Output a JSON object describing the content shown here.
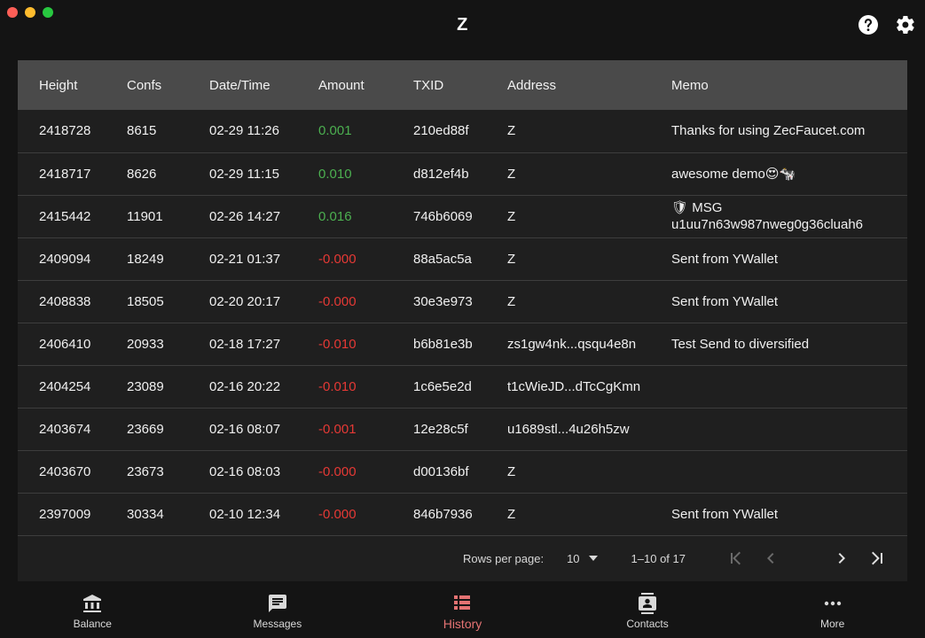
{
  "app": {
    "title": "Z"
  },
  "colors": {
    "positive": "#4caf50",
    "negative": "#e53935",
    "accent": "#e57373"
  },
  "table": {
    "columns": [
      "Height",
      "Confs",
      "Date/Time",
      "Amount",
      "TXID",
      "Address",
      "Memo"
    ],
    "rows": [
      {
        "height": "2418728",
        "confs": "8615",
        "datetime": "02-29 11:26",
        "amount": "0.001",
        "sign": "pos",
        "txid": "210ed88f",
        "address": "Z",
        "memo": "Thanks for using ZecFaucet.com"
      },
      {
        "height": "2418717",
        "confs": "8626",
        "datetime": "02-29 11:15",
        "amount": "0.010",
        "sign": "pos",
        "txid": "d812ef4b",
        "address": "Z",
        "memo": "awesome demo😍🐄"
      },
      {
        "height": "2415442",
        "confs": "11901",
        "datetime": "02-26 14:27",
        "amount": "0.016",
        "sign": "pos",
        "txid": "746b6069",
        "address": "Z",
        "memo": "🛡 MSG u1uu7n63w987nweg0g36cluah6"
      },
      {
        "height": "2409094",
        "confs": "18249",
        "datetime": "02-21 01:37",
        "amount": "-0.000",
        "sign": "neg",
        "txid": "88a5ac5a",
        "address": "Z",
        "memo": "Sent from YWallet"
      },
      {
        "height": "2408838",
        "confs": "18505",
        "datetime": "02-20 20:17",
        "amount": "-0.000",
        "sign": "neg",
        "txid": "30e3e973",
        "address": "Z",
        "memo": "Sent from YWallet"
      },
      {
        "height": "2406410",
        "confs": "20933",
        "datetime": "02-18 17:27",
        "amount": "-0.010",
        "sign": "neg",
        "txid": "b6b81e3b",
        "address": "zs1gw4nk...qsqu4e8n",
        "memo": "Test Send to diversified"
      },
      {
        "height": "2404254",
        "confs": "23089",
        "datetime": "02-16 20:22",
        "amount": "-0.010",
        "sign": "neg",
        "txid": "1c6e5e2d",
        "address": "t1cWieJD...dTcCgKmn",
        "memo": ""
      },
      {
        "height": "2403674",
        "confs": "23669",
        "datetime": "02-16 08:07",
        "amount": "-0.001",
        "sign": "neg",
        "txid": "12e28c5f",
        "address": "u1689stl...4u26h5zw",
        "memo": ""
      },
      {
        "height": "2403670",
        "confs": "23673",
        "datetime": "02-16 08:03",
        "amount": "-0.000",
        "sign": "neg",
        "txid": "d00136bf",
        "address": "Z",
        "memo": ""
      },
      {
        "height": "2397009",
        "confs": "30334",
        "datetime": "02-10 12:34",
        "amount": "-0.000",
        "sign": "neg",
        "txid": "846b7936",
        "address": "Z",
        "memo": "Sent from YWallet"
      }
    ]
  },
  "pagination": {
    "rows_per_page_label": "Rows per page:",
    "rows_per_page_value": "10",
    "range_label": "1–10 of 17"
  },
  "nav": {
    "items": [
      {
        "label": "Balance",
        "icon": "bank-icon",
        "active": false
      },
      {
        "label": "Messages",
        "icon": "message-icon",
        "active": false
      },
      {
        "label": "History",
        "icon": "list-icon",
        "active": true
      },
      {
        "label": "Contacts",
        "icon": "contacts-icon",
        "active": false
      },
      {
        "label": "More",
        "icon": "more-dots-icon",
        "active": false
      }
    ]
  }
}
